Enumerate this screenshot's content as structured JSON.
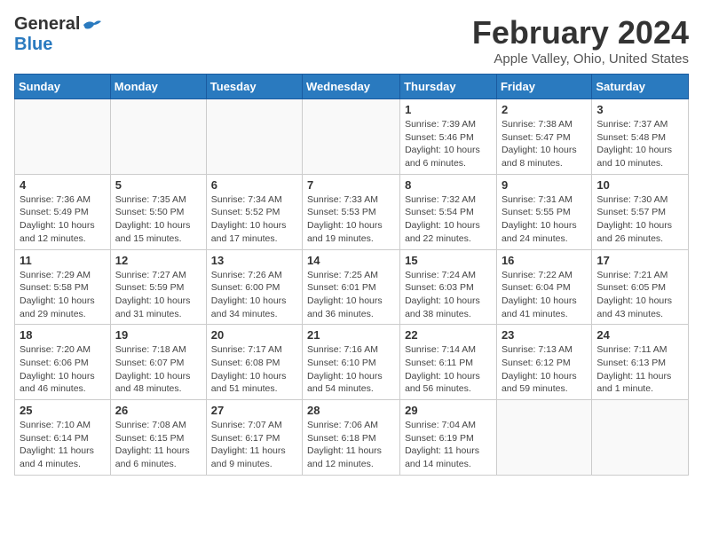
{
  "header": {
    "logo_general": "General",
    "logo_blue": "Blue",
    "month_title": "February 2024",
    "location": "Apple Valley, Ohio, United States"
  },
  "weekdays": [
    "Sunday",
    "Monday",
    "Tuesday",
    "Wednesday",
    "Thursday",
    "Friday",
    "Saturday"
  ],
  "weeks": [
    [
      {
        "day": "",
        "info": ""
      },
      {
        "day": "",
        "info": ""
      },
      {
        "day": "",
        "info": ""
      },
      {
        "day": "",
        "info": ""
      },
      {
        "day": "1",
        "info": "Sunrise: 7:39 AM\nSunset: 5:46 PM\nDaylight: 10 hours\nand 6 minutes."
      },
      {
        "day": "2",
        "info": "Sunrise: 7:38 AM\nSunset: 5:47 PM\nDaylight: 10 hours\nand 8 minutes."
      },
      {
        "day": "3",
        "info": "Sunrise: 7:37 AM\nSunset: 5:48 PM\nDaylight: 10 hours\nand 10 minutes."
      }
    ],
    [
      {
        "day": "4",
        "info": "Sunrise: 7:36 AM\nSunset: 5:49 PM\nDaylight: 10 hours\nand 12 minutes."
      },
      {
        "day": "5",
        "info": "Sunrise: 7:35 AM\nSunset: 5:50 PM\nDaylight: 10 hours\nand 15 minutes."
      },
      {
        "day": "6",
        "info": "Sunrise: 7:34 AM\nSunset: 5:52 PM\nDaylight: 10 hours\nand 17 minutes."
      },
      {
        "day": "7",
        "info": "Sunrise: 7:33 AM\nSunset: 5:53 PM\nDaylight: 10 hours\nand 19 minutes."
      },
      {
        "day": "8",
        "info": "Sunrise: 7:32 AM\nSunset: 5:54 PM\nDaylight: 10 hours\nand 22 minutes."
      },
      {
        "day": "9",
        "info": "Sunrise: 7:31 AM\nSunset: 5:55 PM\nDaylight: 10 hours\nand 24 minutes."
      },
      {
        "day": "10",
        "info": "Sunrise: 7:30 AM\nSunset: 5:57 PM\nDaylight: 10 hours\nand 26 minutes."
      }
    ],
    [
      {
        "day": "11",
        "info": "Sunrise: 7:29 AM\nSunset: 5:58 PM\nDaylight: 10 hours\nand 29 minutes."
      },
      {
        "day": "12",
        "info": "Sunrise: 7:27 AM\nSunset: 5:59 PM\nDaylight: 10 hours\nand 31 minutes."
      },
      {
        "day": "13",
        "info": "Sunrise: 7:26 AM\nSunset: 6:00 PM\nDaylight: 10 hours\nand 34 minutes."
      },
      {
        "day": "14",
        "info": "Sunrise: 7:25 AM\nSunset: 6:01 PM\nDaylight: 10 hours\nand 36 minutes."
      },
      {
        "day": "15",
        "info": "Sunrise: 7:24 AM\nSunset: 6:03 PM\nDaylight: 10 hours\nand 38 minutes."
      },
      {
        "day": "16",
        "info": "Sunrise: 7:22 AM\nSunset: 6:04 PM\nDaylight: 10 hours\nand 41 minutes."
      },
      {
        "day": "17",
        "info": "Sunrise: 7:21 AM\nSunset: 6:05 PM\nDaylight: 10 hours\nand 43 minutes."
      }
    ],
    [
      {
        "day": "18",
        "info": "Sunrise: 7:20 AM\nSunset: 6:06 PM\nDaylight: 10 hours\nand 46 minutes."
      },
      {
        "day": "19",
        "info": "Sunrise: 7:18 AM\nSunset: 6:07 PM\nDaylight: 10 hours\nand 48 minutes."
      },
      {
        "day": "20",
        "info": "Sunrise: 7:17 AM\nSunset: 6:08 PM\nDaylight: 10 hours\nand 51 minutes."
      },
      {
        "day": "21",
        "info": "Sunrise: 7:16 AM\nSunset: 6:10 PM\nDaylight: 10 hours\nand 54 minutes."
      },
      {
        "day": "22",
        "info": "Sunrise: 7:14 AM\nSunset: 6:11 PM\nDaylight: 10 hours\nand 56 minutes."
      },
      {
        "day": "23",
        "info": "Sunrise: 7:13 AM\nSunset: 6:12 PM\nDaylight: 10 hours\nand 59 minutes."
      },
      {
        "day": "24",
        "info": "Sunrise: 7:11 AM\nSunset: 6:13 PM\nDaylight: 11 hours\nand 1 minute."
      }
    ],
    [
      {
        "day": "25",
        "info": "Sunrise: 7:10 AM\nSunset: 6:14 PM\nDaylight: 11 hours\nand 4 minutes."
      },
      {
        "day": "26",
        "info": "Sunrise: 7:08 AM\nSunset: 6:15 PM\nDaylight: 11 hours\nand 6 minutes."
      },
      {
        "day": "27",
        "info": "Sunrise: 7:07 AM\nSunset: 6:17 PM\nDaylight: 11 hours\nand 9 minutes."
      },
      {
        "day": "28",
        "info": "Sunrise: 7:06 AM\nSunset: 6:18 PM\nDaylight: 11 hours\nand 12 minutes."
      },
      {
        "day": "29",
        "info": "Sunrise: 7:04 AM\nSunset: 6:19 PM\nDaylight: 11 hours\nand 14 minutes."
      },
      {
        "day": "",
        "info": ""
      },
      {
        "day": "",
        "info": ""
      }
    ]
  ]
}
